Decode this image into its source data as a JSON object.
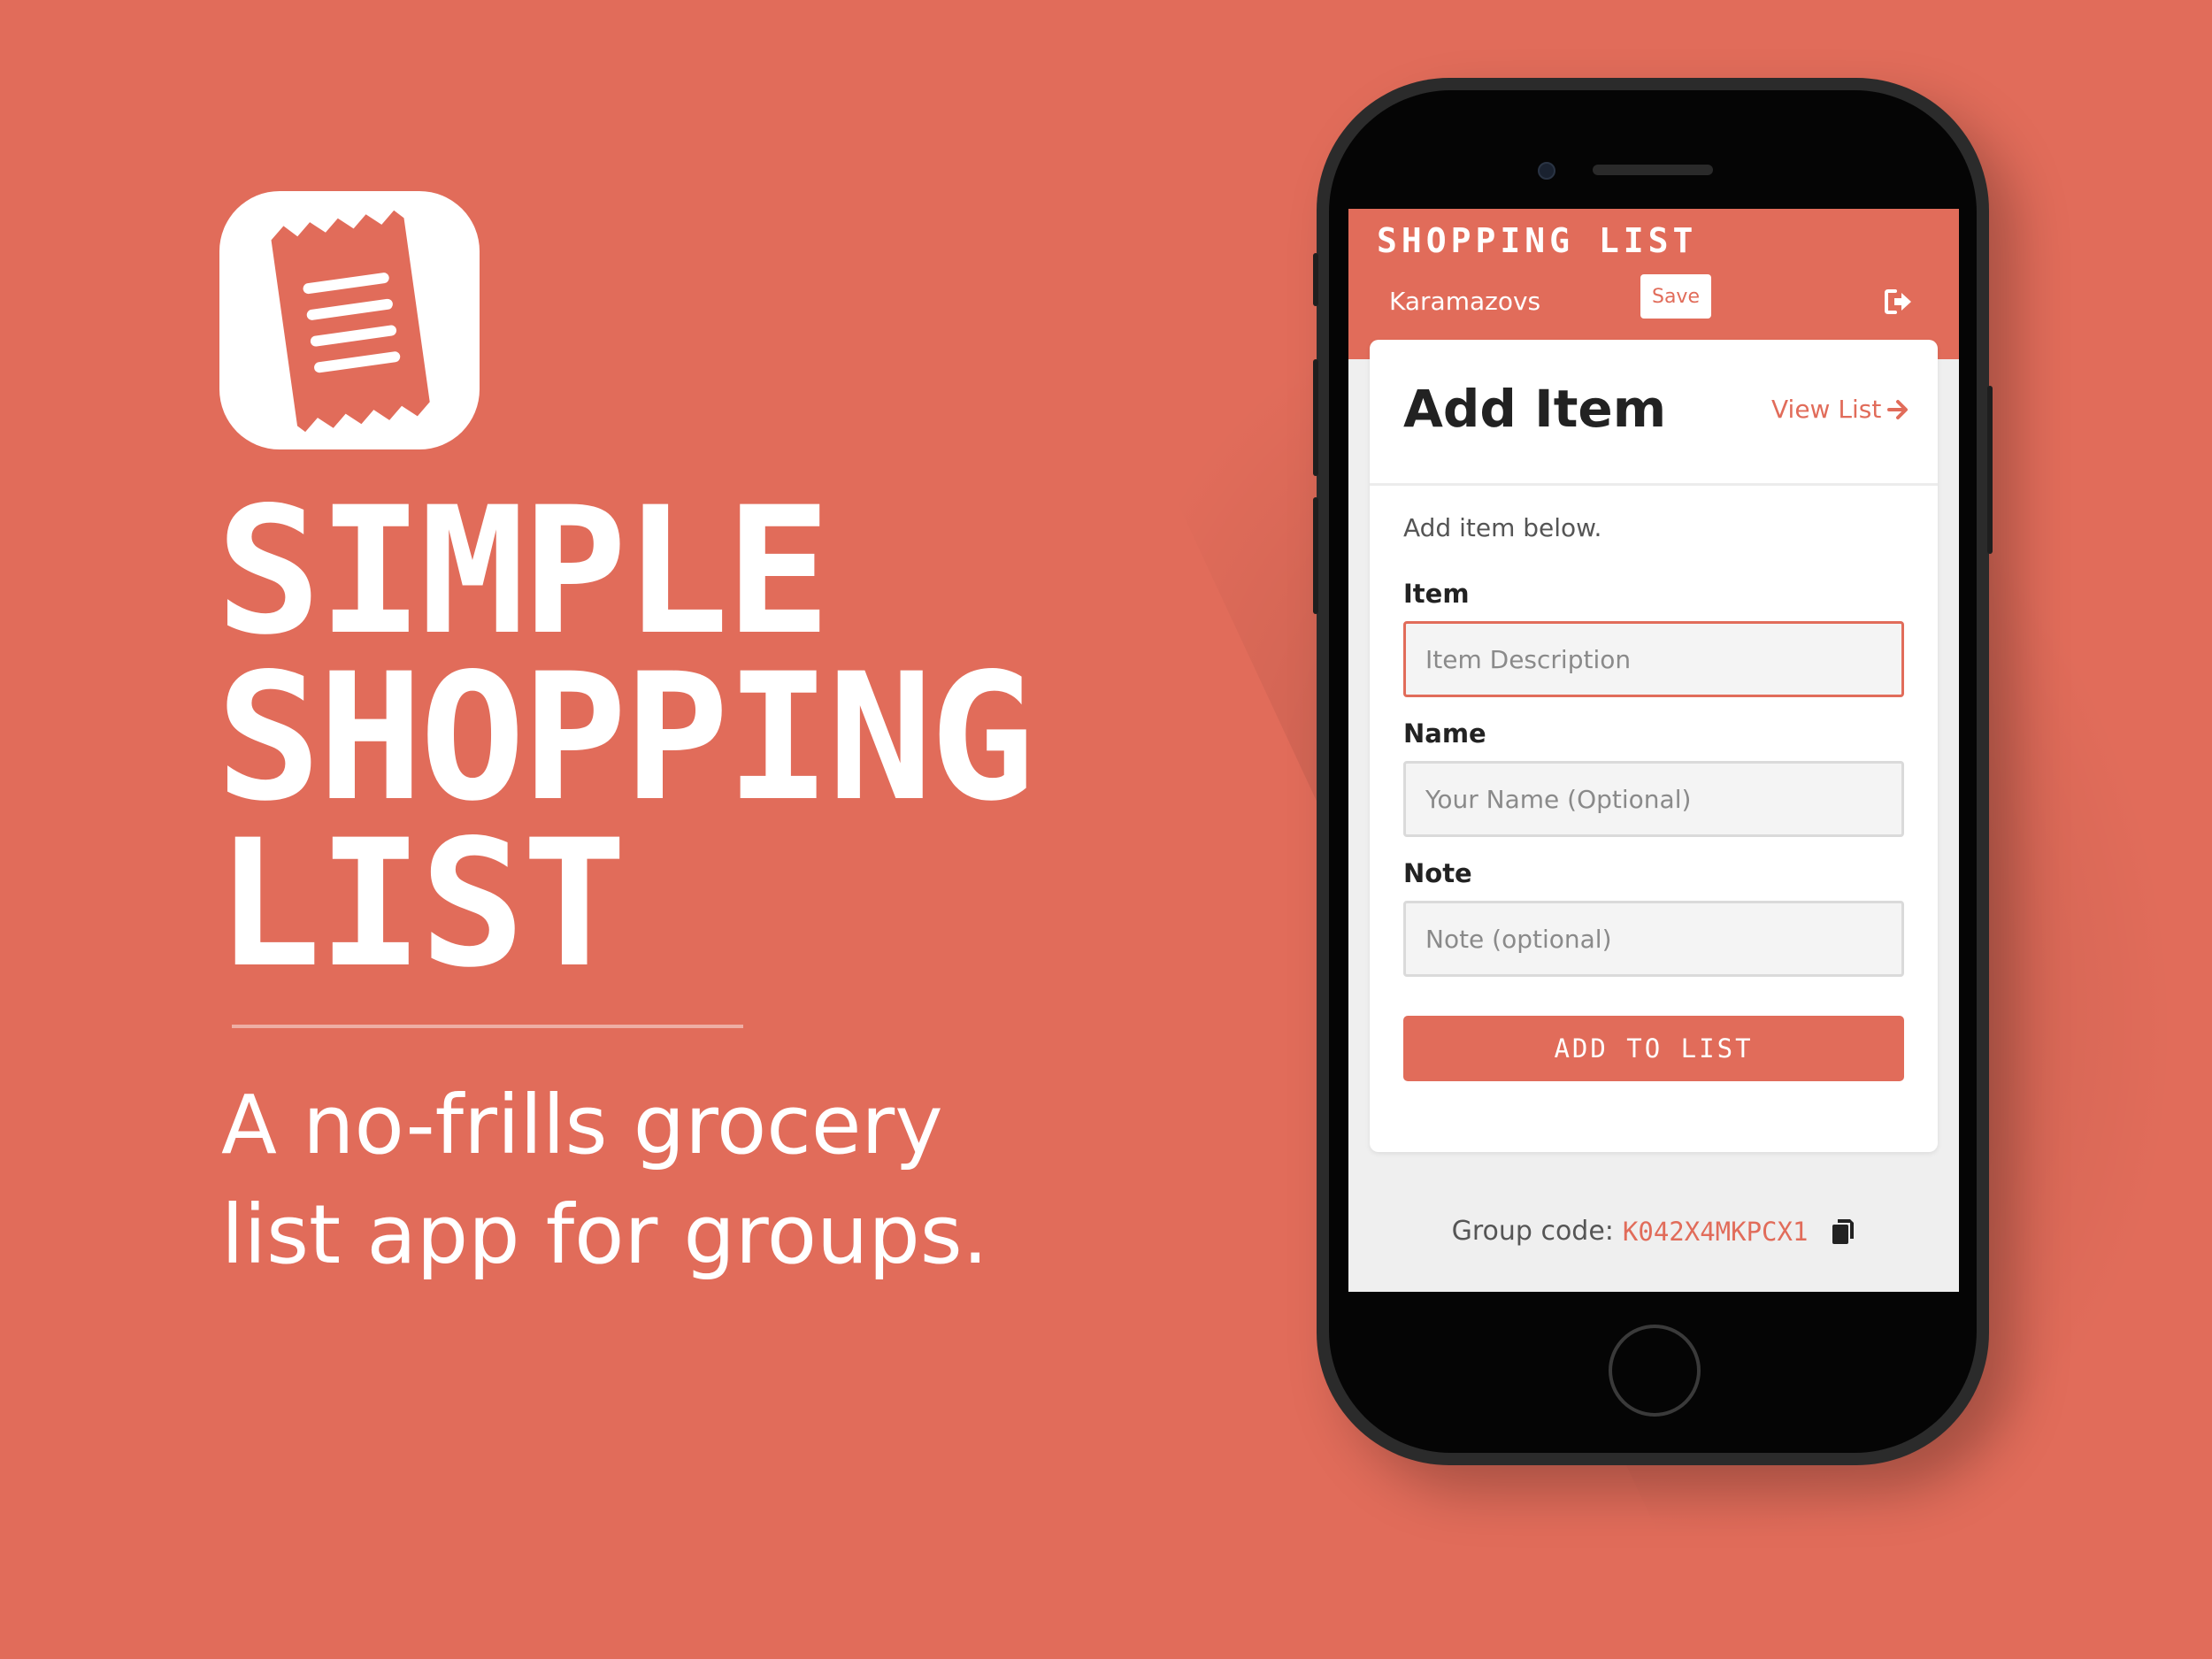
{
  "promo": {
    "headline": [
      "SIMPLE",
      "SHOPPING",
      "LIST"
    ],
    "tagline": [
      "A no-frills grocery",
      "list app for groups."
    ],
    "app_icon": "receipt-icon"
  },
  "app": {
    "header": {
      "title": "SHOPPING LIST",
      "group_name": "Karamazovs",
      "save_label": "Save",
      "logout_icon": "sign-out-icon"
    },
    "card": {
      "title": "Add Item",
      "view_list_label": "View List",
      "view_list_icon": "arrow-right-icon",
      "intro": "Add item below.",
      "fields": [
        {
          "label": "Item",
          "value": "",
          "placeholder": "Item Description",
          "focused": true
        },
        {
          "label": "Name",
          "value": "",
          "placeholder": "Your Name (Optional)",
          "focused": false
        },
        {
          "label": "Note",
          "value": "",
          "placeholder": "Note (optional)",
          "focused": false
        }
      ],
      "submit_label": "ADD TO LIST"
    },
    "footer": {
      "group_code_label": "Group code:",
      "group_code": "K042X4MKPCX1",
      "copy_icon": "copy-icon"
    }
  },
  "colors": {
    "background": "#e16c5a",
    "accent": "#e16c5a",
    "phone_body": "#2b2b2b",
    "screen_bg": "#efefef"
  }
}
